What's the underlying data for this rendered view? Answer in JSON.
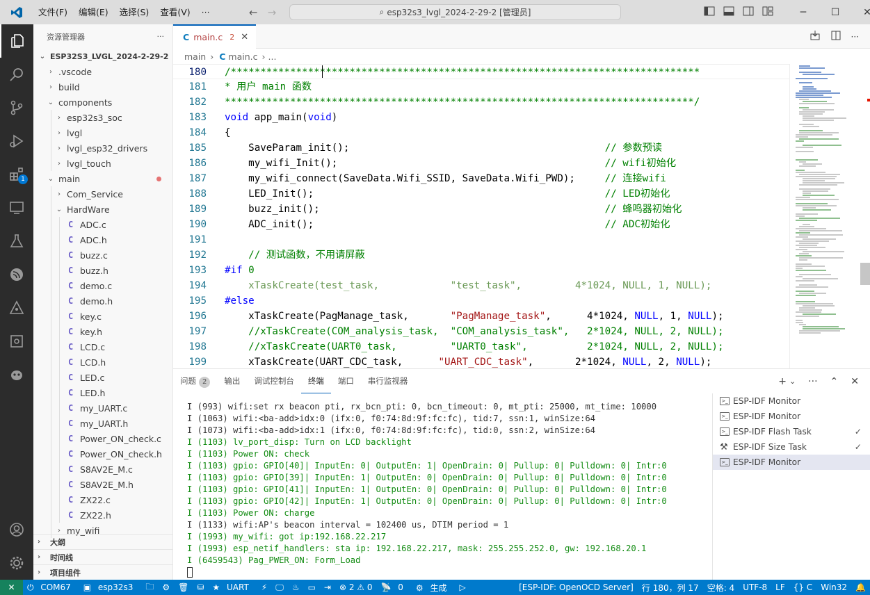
{
  "titlebar": {
    "menu": [
      "文件(F)",
      "编辑(E)",
      "选择(S)",
      "查看(V)",
      "···"
    ],
    "search_text": "esp32s3_lvgl_2024-2-29-2 [管理员]"
  },
  "sidebar": {
    "header": "资源管理器",
    "more": "···",
    "root": "ESP32S3_LVGL_2024-2-29-2",
    "tree": [
      {
        "label": ".vscode",
        "depth": 1,
        "kind": "folder",
        "open": false
      },
      {
        "label": "build",
        "depth": 1,
        "kind": "folder",
        "open": false
      },
      {
        "label": "components",
        "depth": 1,
        "kind": "folder",
        "open": true
      },
      {
        "label": "esp32s3_soc",
        "depth": 2,
        "kind": "folder",
        "open": false
      },
      {
        "label": "lvgl",
        "depth": 2,
        "kind": "folder",
        "open": false
      },
      {
        "label": "lvgl_esp32_drivers",
        "depth": 2,
        "kind": "folder",
        "open": false
      },
      {
        "label": "lvgl_touch",
        "depth": 2,
        "kind": "folder",
        "open": false
      },
      {
        "label": "main",
        "depth": 1,
        "kind": "folder",
        "open": true,
        "modified": true
      },
      {
        "label": "Com_Service",
        "depth": 2,
        "kind": "folder",
        "open": false
      },
      {
        "label": "HardWare",
        "depth": 2,
        "kind": "folder",
        "open": true
      },
      {
        "label": "ADC.c",
        "depth": 3,
        "kind": "file"
      },
      {
        "label": "ADC.h",
        "depth": 3,
        "kind": "file"
      },
      {
        "label": "buzz.c",
        "depth": 3,
        "kind": "file"
      },
      {
        "label": "buzz.h",
        "depth": 3,
        "kind": "file"
      },
      {
        "label": "demo.c",
        "depth": 3,
        "kind": "file"
      },
      {
        "label": "demo.h",
        "depth": 3,
        "kind": "file"
      },
      {
        "label": "key.c",
        "depth": 3,
        "kind": "file"
      },
      {
        "label": "key.h",
        "depth": 3,
        "kind": "file"
      },
      {
        "label": "LCD.c",
        "depth": 3,
        "kind": "file"
      },
      {
        "label": "LCD.h",
        "depth": 3,
        "kind": "file"
      },
      {
        "label": "LED.c",
        "depth": 3,
        "kind": "file"
      },
      {
        "label": "LED.h",
        "depth": 3,
        "kind": "file"
      },
      {
        "label": "my_UART.c",
        "depth": 3,
        "kind": "file"
      },
      {
        "label": "my_UART.h",
        "depth": 3,
        "kind": "file"
      },
      {
        "label": "Power_ON_check.c",
        "depth": 3,
        "kind": "file"
      },
      {
        "label": "Power_ON_check.h",
        "depth": 3,
        "kind": "file"
      },
      {
        "label": "S8AV2E_M.c",
        "depth": 3,
        "kind": "file"
      },
      {
        "label": "S8AV2E_M.h",
        "depth": 3,
        "kind": "file"
      },
      {
        "label": "ZX22.c",
        "depth": 3,
        "kind": "file"
      },
      {
        "label": "ZX22.h",
        "depth": 3,
        "kind": "file"
      },
      {
        "label": "my_wifi",
        "depth": 2,
        "kind": "folder",
        "open": false
      }
    ],
    "sections": [
      "大纲",
      "时间线",
      "项目组件"
    ]
  },
  "activity_badge": "1",
  "tab": {
    "icon": "C",
    "name": "main.c",
    "problems": "2",
    "close": "✕"
  },
  "breadcrumb": {
    "folder": "main",
    "sep": "›",
    "file": "main.c",
    "sep2": "›",
    "more": "..."
  },
  "editor": {
    "lines": [
      {
        "n": "180",
        "html": "<span class='cm'>/*******************************************************************************</span>",
        "cur": true
      },
      {
        "n": "181",
        "html": "<span class='cm'>* 用户 main 函数</span>"
      },
      {
        "n": "182",
        "html": "<span class='cm'>*******************************************************************************/</span>"
      },
      {
        "n": "183",
        "html": "<span class='kw'>void</span> app_main(<span class='kw'>void</span>)"
      },
      {
        "n": "184",
        "html": "{"
      },
      {
        "n": "185",
        "html": "    SaveParam_init();                                           <span class='cm'>// 参数预读</span>"
      },
      {
        "n": "186",
        "html": "    my_wifi_Init();                                             <span class='cm'>// wifi初始化</span>"
      },
      {
        "n": "187",
        "html": "    my_wifi_connect(SaveData.Wifi_SSID, SaveData.Wifi_PWD);     <span class='cm'>// 连接wifi</span>"
      },
      {
        "n": "188",
        "html": "    LED_Init();                                                 <span class='cm'>// LED初始化</span>"
      },
      {
        "n": "189",
        "html": "    buzz_init();                                                <span class='cm'>// 蜂鸣器初始化</span>"
      },
      {
        "n": "190",
        "html": "    ADC_init();                                                 <span class='cm'>// ADC初始化</span>"
      },
      {
        "n": "191",
        "html": ""
      },
      {
        "n": "192",
        "html": "    <span class='cm'>// 测试函数，不用请屏蔽</span>"
      },
      {
        "n": "193",
        "html": "<span class='pp'>#if</span> <span class='cm'>0</span>"
      },
      {
        "n": "194",
        "html": "<span class='dim'>    xTaskCreate(test_task,            \"test_task\",         4*1024, NULL, 1, NULL);</span>"
      },
      {
        "n": "195",
        "html": "<span class='pp'>#else</span>"
      },
      {
        "n": "196",
        "html": "    xTaskCreate(PagManage_task,       <span class='st'>\"PagManage_task\"</span>,      4*1024, <span class='kw'>NULL</span>, 1, <span class='kw'>NULL</span>);"
      },
      {
        "n": "197",
        "html": "    <span class='cm'>//xTaskCreate(COM_analysis_task,  \"COM_analysis_task\",   2*1024, NULL, 2, NULL);</span>"
      },
      {
        "n": "198",
        "html": "    <span class='cm'>//xTaskCreate(UART0_task,         \"UART0_task\",          2*1024, NULL, 2, NULL);</span>"
      },
      {
        "n": "199",
        "html": "    xTaskCreate(UART_CDC_task,      <span class='st'>\"UART_CDC_task\"</span>,       2*1024, <span class='kw'>NULL</span>, 2, <span class='kw'>NULL</span>);"
      }
    ]
  },
  "panel": {
    "tabs": [
      {
        "label": "问题",
        "count": "2"
      },
      {
        "label": "输出"
      },
      {
        "label": "调试控制台"
      },
      {
        "label": "终端",
        "active": true
      },
      {
        "label": "端口"
      },
      {
        "label": "串行监视器"
      }
    ],
    "actions": [
      "+",
      "⌄",
      "···",
      "⌃",
      "✕"
    ],
    "terminal": [
      {
        "t": "I (993) wifi:set rx beacon pti, rx_bcn_pti: 0, bcn_timeout: 0, mt_pti: 25000, mt_time: 10000",
        "c": "b"
      },
      {
        "t": "I (1063) wifi:<ba-add>idx:0 (ifx:0, f0:74:8d:9f:fc:fc), tid:7, ssn:1, winSize:64",
        "c": "b"
      },
      {
        "t": "I (1073) wifi:<ba-add>idx:1 (ifx:0, f0:74:8d:9f:fc:fc), tid:0, ssn:2, winSize:64",
        "c": "b"
      },
      {
        "t": "I (1103) lv_port_disp: Turn on LCD backlight",
        "c": "g"
      },
      {
        "t": "I (1103) Power ON: check",
        "c": "g"
      },
      {
        "t": "I (1103) gpio: GPIO[40]| InputEn: 0| OutputEn: 1| OpenDrain: 0| Pullup: 0| Pulldown: 0| Intr:0",
        "c": "g"
      },
      {
        "t": "I (1103) gpio: GPIO[39]| InputEn: 1| OutputEn: 0| OpenDrain: 0| Pullup: 0| Pulldown: 0| Intr:0",
        "c": "g"
      },
      {
        "t": "I (1103) gpio: GPIO[41]| InputEn: 1| OutputEn: 0| OpenDrain: 0| Pullup: 0| Pulldown: 0| Intr:0",
        "c": "g"
      },
      {
        "t": "I (1103) gpio: GPIO[42]| InputEn: 1| OutputEn: 0| OpenDrain: 0| Pullup: 0| Pulldown: 0| Intr:0",
        "c": "g"
      },
      {
        "t": "I (1103) Power ON: charge",
        "c": "g"
      },
      {
        "t": "I (1133) wifi:AP's beacon interval = 102400 us, DTIM period = 1",
        "c": "b"
      },
      {
        "t": "I (1993) my_wifi: got ip:192.168.22.217",
        "c": "g"
      },
      {
        "t": "I (1993) esp_netif_handlers: sta ip: 192.168.22.217, mask: 255.255.252.0, gw: 192.168.20.1",
        "c": "g"
      },
      {
        "t": "I (6459543) Pag_PWER_ON: Form_Load",
        "c": "g"
      }
    ],
    "terminal_list": [
      {
        "label": "ESP-IDF Monitor",
        "icon": "terminal"
      },
      {
        "label": "ESP-IDF Monitor",
        "icon": "terminal"
      },
      {
        "label": "ESP-IDF Flash Task",
        "icon": "terminal",
        "check": true
      },
      {
        "label": "ESP-IDF Size Task",
        "icon": "tools",
        "check": true
      },
      {
        "label": "ESP-IDF Monitor",
        "icon": "terminal",
        "selected": true
      }
    ]
  },
  "statusbar": {
    "remote": "✕",
    "port": "COM67",
    "target": "esp32s3",
    "uart": "UART",
    "problems": "⊗ 2 ⚠ 0",
    "ports": "0",
    "build": "生成",
    "server": "[ESP-IDF: OpenOCD Server]",
    "position": "行 180，列 17",
    "spaces": "空格: 4",
    "encoding": "UTF-8",
    "eol": "LF",
    "lang": "{} C",
    "platform": "Win32"
  }
}
